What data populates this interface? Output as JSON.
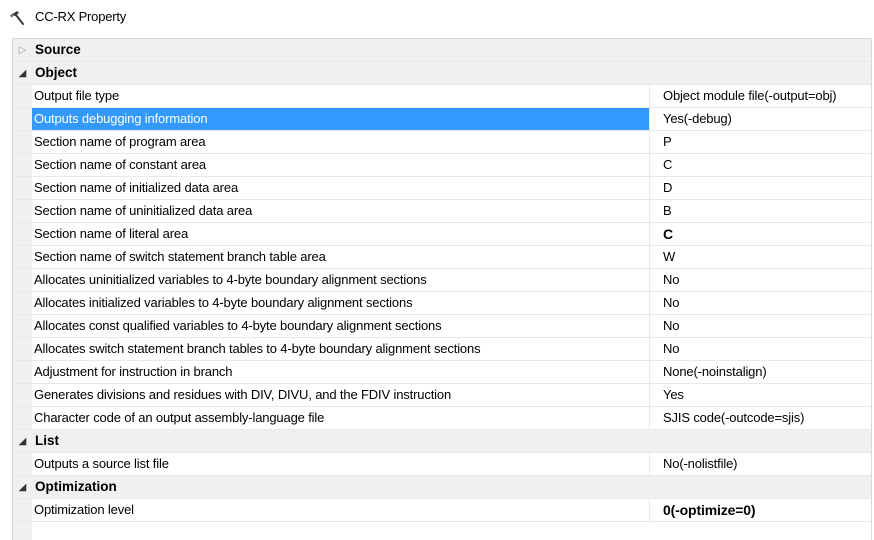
{
  "window": {
    "title": "CC-RX Property",
    "icon": "hammer-icon"
  },
  "categories": [
    {
      "label": "Source",
      "expanded": false
    },
    {
      "label": "Object",
      "expanded": true
    },
    {
      "label": "List",
      "expanded": true
    },
    {
      "label": "Optimization",
      "expanded": true
    }
  ],
  "object_props": [
    {
      "name": "Output file type",
      "value": "Object module file(-output=obj)"
    },
    {
      "name": "Outputs debugging information",
      "value": "Yes(-debug)",
      "selected": true
    },
    {
      "name": "Section name of program area",
      "value": "P"
    },
    {
      "name": "Section name of constant area",
      "value": "C"
    },
    {
      "name": "Section name of initialized data area",
      "value": "D"
    },
    {
      "name": "Section name of uninitialized data area",
      "value": "B"
    },
    {
      "name": "Section name of literal area",
      "value": "C",
      "bold": true
    },
    {
      "name": "Section name of switch statement branch table area",
      "value": "W"
    },
    {
      "name": "Allocates uninitialized variables to 4-byte boundary alignment sections",
      "value": "No"
    },
    {
      "name": "Allocates initialized variables to 4-byte boundary alignment sections",
      "value": "No"
    },
    {
      "name": "Allocates const qualified variables to 4-byte boundary alignment sections",
      "value": "No"
    },
    {
      "name": "Allocates switch statement branch tables to 4-byte boundary alignment sections",
      "value": "No"
    },
    {
      "name": "Adjustment for instruction in branch",
      "value": "None(-noinstalign)"
    },
    {
      "name": "Generates divisions and residues with DIV, DIVU, and the FDIV instruction",
      "value": "Yes"
    },
    {
      "name": "Character code of an output assembly-language file",
      "value": "SJIS code(-outcode=sjis)"
    }
  ],
  "list_props": [
    {
      "name": "Outputs a source list file",
      "value": "No(-nolistfile)"
    }
  ],
  "optimization_props": [
    {
      "name": "Optimization level",
      "value": "0(-optimize=0)",
      "bold": true
    }
  ],
  "colors": {
    "selection": "#3399ff",
    "category_bg": "#f0f0f0",
    "grid_line": "#e9e9e9"
  }
}
